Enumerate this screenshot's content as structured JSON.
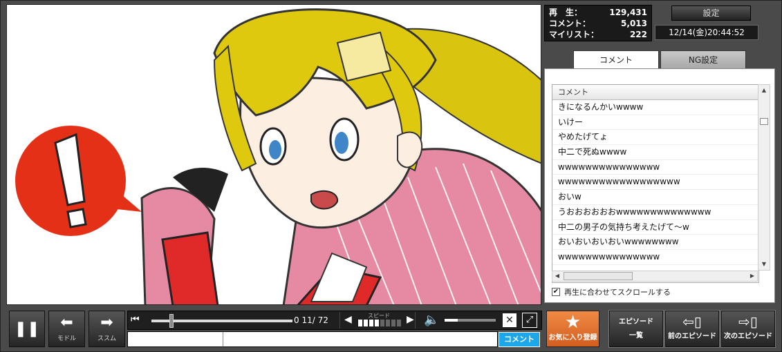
{
  "stats": {
    "views_label": "再　生：",
    "views": "129,431",
    "comments_label": "コメント：",
    "comments": "5,013",
    "mylist_label": "マイリスト：",
    "mylist": "222"
  },
  "header": {
    "settings": "設定",
    "datetime": "12/14(金)20:44:52"
  },
  "tabs": {
    "comment": "コメント",
    "ng": "NG設定"
  },
  "comment_list": {
    "header": "コメント",
    "items": [
      "きになるんかいwwww",
      "いけー",
      "やめたげてょ",
      "中二で死ぬwwww",
      "wwwwwwwwwwwwwww",
      "wwwwwwwwwwwwwwwwww",
      "おいw",
      "うおおおおおおwwwwwwwwwwwwww",
      "中二の男子の気持ち考えたげて〜w",
      "おいおいおいおいwwwwwwww",
      "wwwwwwwwwwwwwww"
    ],
    "autoscroll_label": "再生に合わせてスクロールする",
    "autoscroll_checked": "✔"
  },
  "controls": {
    "pause_icon": "pause-icon",
    "prev": "モドル",
    "next": "ススム",
    "time": "0 11/ 72",
    "speed_label": "スピード",
    "speed_level": 0.5,
    "volume_level": 0.25,
    "comment_button": "コメント",
    "comment_placeholder": ""
  },
  "side_buttons": {
    "favorite": "お気に入り登録",
    "episode_list_1": "エピソード",
    "episode_list_2": "一覧",
    "prev_episode": "前のエピソード",
    "next_episode": "次のエピソード"
  },
  "colors": {
    "accent_orange": "#e06a2a",
    "accent_blue": "#1ea7e8"
  }
}
